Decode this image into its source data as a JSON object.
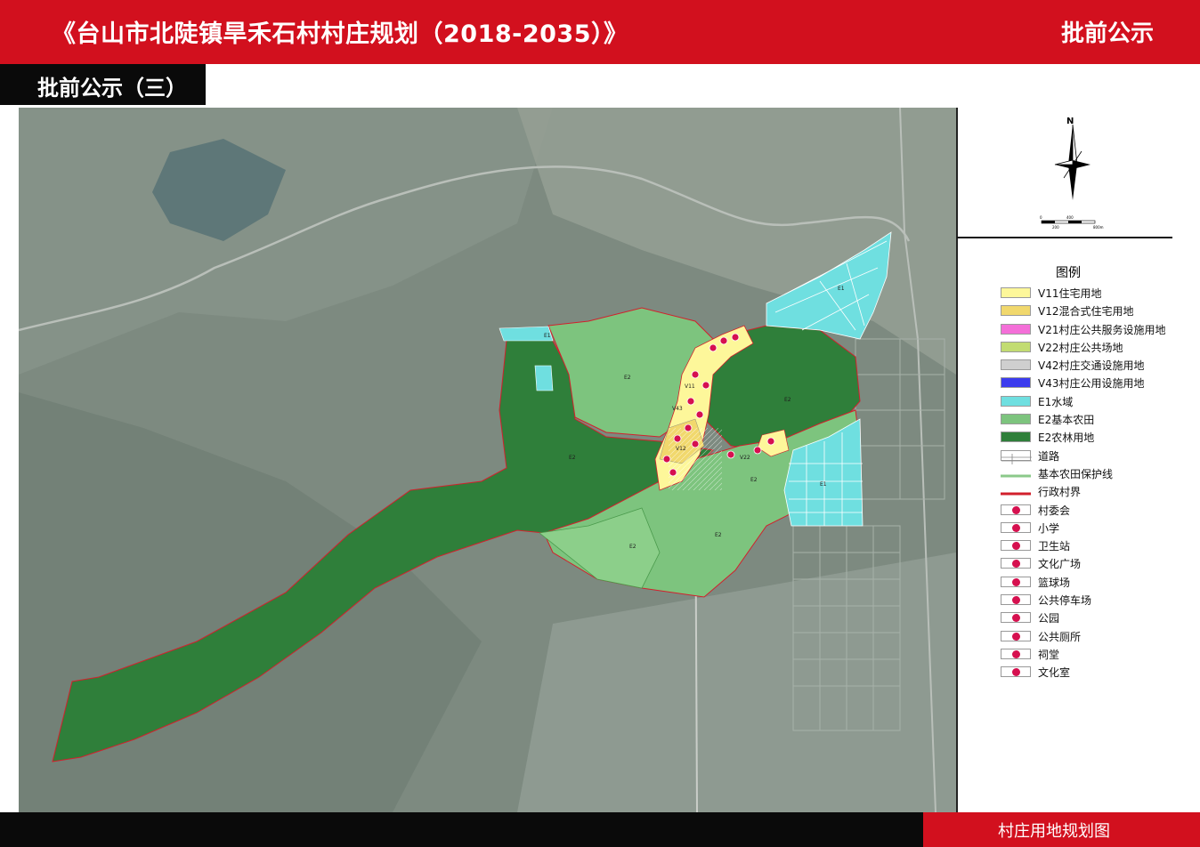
{
  "header": {
    "title": "《台山市北陡镇旱禾石村村庄规划（2018-2035）》",
    "status": "批前公示",
    "accent": "#d2101e"
  },
  "section": {
    "label": "批前公示（三）"
  },
  "map": {
    "north_label": "N",
    "scale_labels": [
      "0",
      "400",
      "200",
      "800m"
    ],
    "zone_labels": [
      "E1",
      "E2",
      "E2",
      "E2",
      "E2",
      "E2",
      "E2",
      "E1",
      "E1",
      "V11",
      "V12",
      "V22",
      "V43"
    ]
  },
  "legend": {
    "title": "图例",
    "items": [
      {
        "label": "V11住宅用地",
        "kind": "fill",
        "color": "#fdf79a"
      },
      {
        "label": "V12混合式住宅用地",
        "kind": "fill",
        "color": "#f1d86d"
      },
      {
        "label": "V21村庄公共服务设施用地",
        "kind": "fill",
        "color": "#f46fd8"
      },
      {
        "label": "V22村庄公共场地",
        "kind": "fill",
        "color": "#c2dc72"
      },
      {
        "label": "V42村庄交通设施用地",
        "kind": "fill",
        "color": "#cfcfcf"
      },
      {
        "label": "V43村庄公用设施用地",
        "kind": "fill",
        "color": "#3c3cee"
      },
      {
        "label": "E1水域",
        "kind": "fill",
        "color": "#6fdfe0"
      },
      {
        "label": "E2基本农田",
        "kind": "fill",
        "color": "#7dc47e"
      },
      {
        "label": "E2农林用地",
        "kind": "fill",
        "color": "#2f7f3a"
      },
      {
        "label": "道路",
        "kind": "road",
        "color": "#ffffff"
      },
      {
        "label": "基本农田保护线",
        "kind": "line",
        "color": "#8bc98a"
      },
      {
        "label": "行政村界",
        "kind": "line",
        "color": "#d2202c"
      },
      {
        "label": "村委会",
        "kind": "symbol",
        "color": "#d6104f"
      },
      {
        "label": "小学",
        "kind": "symbol",
        "color": "#d6104f"
      },
      {
        "label": "卫生站",
        "kind": "symbol",
        "color": "#d6104f"
      },
      {
        "label": "文化广场",
        "kind": "symbol",
        "color": "#d6104f"
      },
      {
        "label": "篮球场",
        "kind": "symbol",
        "color": "#d6104f"
      },
      {
        "label": "公共停车场",
        "kind": "symbol",
        "color": "#d6104f"
      },
      {
        "label": "公园",
        "kind": "symbol",
        "color": "#d6104f"
      },
      {
        "label": "公共厕所",
        "kind": "symbol",
        "color": "#d6104f"
      },
      {
        "label": "祠堂",
        "kind": "symbol",
        "color": "#d6104f"
      },
      {
        "label": "文化室",
        "kind": "symbol",
        "color": "#d6104f"
      }
    ]
  },
  "footer": {
    "label": "村庄用地规划图"
  }
}
